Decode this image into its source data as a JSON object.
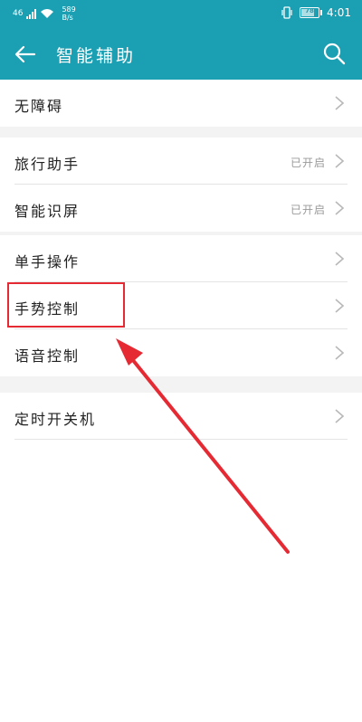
{
  "status_bar": {
    "signal": "46",
    "network_speed": "589\nB/s",
    "battery": "78",
    "time": "4:01"
  },
  "app_bar": {
    "title": "智能辅助",
    "back_icon": "arrow-left-icon",
    "search_icon": "search-icon"
  },
  "sections": [
    {
      "items": [
        {
          "label": "无障碍",
          "value": ""
        }
      ]
    },
    {
      "items": [
        {
          "label": "旅行助手",
          "value": "已开启"
        },
        {
          "label": "智能识屏",
          "value": "已开启"
        }
      ]
    },
    {
      "items": [
        {
          "label": "单手操作",
          "value": ""
        },
        {
          "label": "手势控制",
          "value": ""
        },
        {
          "label": "语音控制",
          "value": ""
        }
      ]
    },
    {
      "items": [
        {
          "label": "定时开关机",
          "value": ""
        }
      ]
    }
  ],
  "annotation": {
    "color": "#e62a34",
    "highlighted_item": "手势控制"
  },
  "colors": {
    "accent": "#1a9fb3",
    "background": "#ffffff",
    "section_gap": "#f3f3f3"
  }
}
